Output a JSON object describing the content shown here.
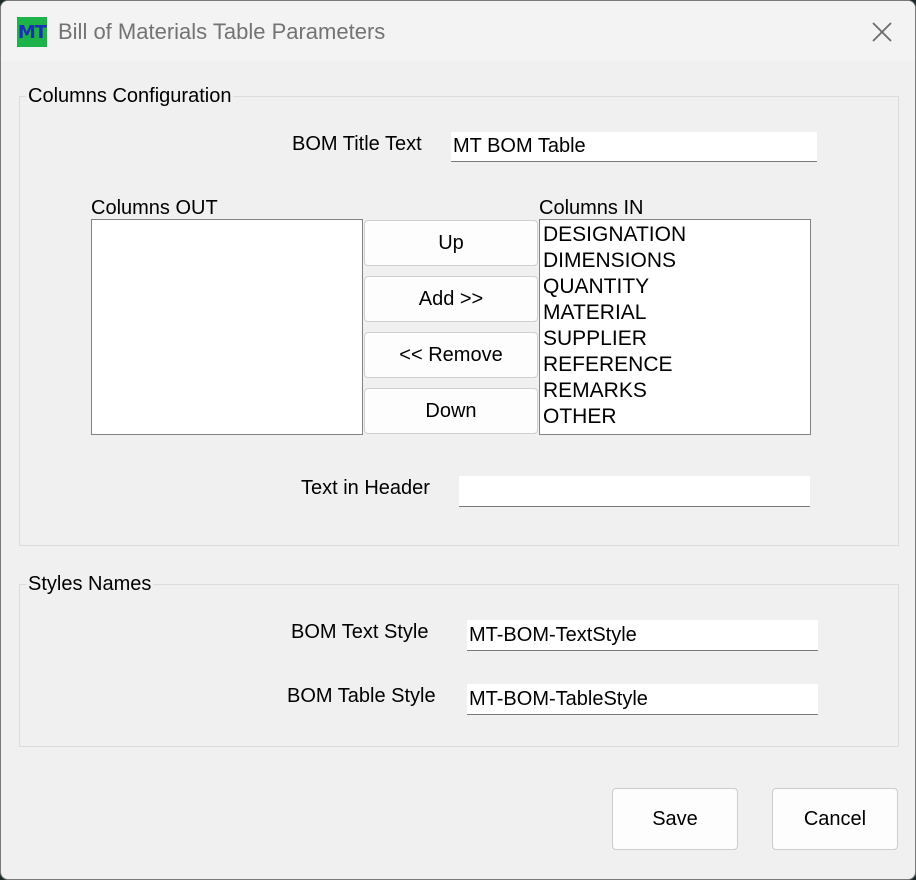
{
  "window": {
    "title": "Bill of Materials Table Parameters",
    "app_icon_text": "MT"
  },
  "columns_config": {
    "legend": "Columns Configuration",
    "bom_title_label": "BOM Title Text",
    "bom_title_value": "MT BOM Table",
    "columns_out_label": "Columns OUT",
    "columns_out_items": [],
    "columns_in_label": "Columns IN",
    "columns_in_items": [
      "DESIGNATION",
      "DIMENSIONS",
      "QUANTITY",
      "MATERIAL",
      "SUPPLIER",
      "REFERENCE",
      "REMARKS",
      "OTHER"
    ],
    "buttons": {
      "up": "Up",
      "add": "Add >>",
      "remove": "<< Remove",
      "down": "Down"
    },
    "header_text_label": "Text in Header",
    "header_text_value": ""
  },
  "styles": {
    "legend": "Styles Names",
    "text_style_label": "BOM Text Style",
    "text_style_value": "MT-BOM-TextStyle",
    "table_style_label": "BOM Table Style",
    "table_style_value": "MT-BOM-TableStyle"
  },
  "footer": {
    "save": "Save",
    "cancel": "Cancel"
  },
  "colors": {
    "icon_bg": "#1db34a",
    "icon_text": "#1a2fb5",
    "window_bg": "#f0f0f0"
  }
}
